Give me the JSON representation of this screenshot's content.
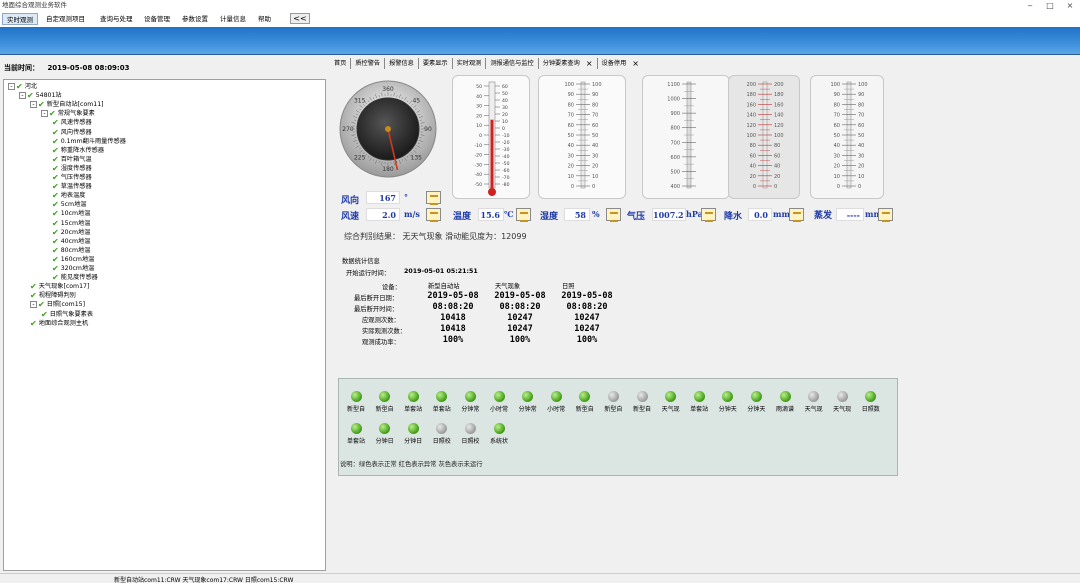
{
  "window": {
    "title": "地面综合观测业务软件"
  },
  "menu": {
    "items": [
      "实时观测",
      "自定观测项目",
      "查询与处理",
      "设备管理",
      "参数设置",
      "计量信息",
      "帮助"
    ],
    "collapse": "<<"
  },
  "current_time": {
    "label": "当前时间：",
    "value": "2019-05-08 08:09:03"
  },
  "tree": [
    {
      "label": "河北",
      "depth": 0,
      "expander": "-"
    },
    {
      "label": "54801站",
      "depth": 1,
      "expander": "-"
    },
    {
      "label": "新型自动站[com11]",
      "depth": 2,
      "expander": "-"
    },
    {
      "label": "常规气象要素",
      "depth": 3,
      "expander": "-"
    },
    {
      "label": "风速传感器",
      "depth": 4
    },
    {
      "label": "风向传感器",
      "depth": 4
    },
    {
      "label": "0.1mm翻斗雨量传感器",
      "depth": 4
    },
    {
      "label": "称重降水传感器",
      "depth": 4
    },
    {
      "label": "百叶箱气温",
      "depth": 4
    },
    {
      "label": "湿度传感器",
      "depth": 4
    },
    {
      "label": "气压传感器",
      "depth": 4
    },
    {
      "label": "草温传感器",
      "depth": 4
    },
    {
      "label": "地表温度",
      "depth": 4
    },
    {
      "label": "5cm地温",
      "depth": 4
    },
    {
      "label": "10cm地温",
      "depth": 4
    },
    {
      "label": "15cm地温",
      "depth": 4
    },
    {
      "label": "20cm地温",
      "depth": 4
    },
    {
      "label": "40cm地温",
      "depth": 4
    },
    {
      "label": "80cm地温",
      "depth": 4
    },
    {
      "label": "160cm地温",
      "depth": 4
    },
    {
      "label": "320cm地温",
      "depth": 4
    },
    {
      "label": "能见度传感器",
      "depth": 4
    },
    {
      "label": "天气现象[com17]",
      "depth": 2
    },
    {
      "label": "视程障碍判别",
      "depth": 2
    },
    {
      "label": "日照[com15]",
      "depth": 2,
      "expander": "-"
    },
    {
      "label": "日照气象要素表",
      "depth": 3
    },
    {
      "label": "地面综合观测主机",
      "depth": 2
    }
  ],
  "status_bar": "新型自动站com11:CRW  天气现象com17:CRW  日照com15:CRW",
  "tabs": [
    {
      "label": "首页"
    },
    {
      "label": "质控警告"
    },
    {
      "label": "报警信息"
    },
    {
      "label": "要素显示"
    },
    {
      "label": "实时观测"
    },
    {
      "label": "测报通信与监控"
    },
    {
      "label": "分钟要素查询",
      "close": "×"
    },
    {
      "label": "设备停用",
      "close": "×"
    }
  ],
  "gauges": {
    "wind_dir": {
      "label": "风向",
      "value": "167",
      "unit": "°",
      "angle_deg": 167,
      "dial": [
        "360",
        "45",
        "90",
        "135",
        "180",
        "225",
        "270",
        "315"
      ]
    },
    "wind_speed": {
      "label": "风速",
      "value": "2.0",
      "unit": "m/s"
    },
    "temperature": {
      "label": "温度",
      "value": "15.6",
      "unit": "℃",
      "level": 15.6,
      "scale_left": [
        "50",
        "40",
        "30",
        "20",
        "10",
        "0",
        "-10",
        "-20",
        "-30",
        "-40",
        "-50"
      ],
      "scale_right": [
        "60",
        "50",
        "40",
        "30",
        "20",
        "10",
        "0",
        "-10",
        "-20",
        "-30",
        "-40",
        "-50",
        "-60",
        "-70",
        "-80"
      ]
    },
    "humidity": {
      "label": "湿度",
      "value": "58",
      "unit": "%",
      "scale": [
        "100",
        "90",
        "80",
        "70",
        "60",
        "50",
        "40",
        "30",
        "20",
        "10",
        "0"
      ]
    },
    "pressure": {
      "label": "气压",
      "value": "1007.2",
      "unit": "hPa",
      "scale": [
        "1100",
        "1000",
        "900",
        "800",
        "700",
        "600",
        "500",
        "400"
      ]
    },
    "precip": {
      "label": "降水",
      "value": "0.0",
      "unit": "mm",
      "scale": [
        "200",
        "180",
        "160",
        "140",
        "120",
        "100",
        "80",
        "60",
        "40",
        "20",
        "0"
      ]
    },
    "evap": {
      "label": "蒸发",
      "value": "----",
      "unit": "mm",
      "scale": [
        "100",
        "90",
        "80",
        "70",
        "60",
        "50",
        "40",
        "30",
        "20",
        "10",
        "0"
      ]
    }
  },
  "judge": {
    "text": "综合判别结果：  无天气现象   滑动能见度为：12099"
  },
  "stats": {
    "title": "数据统计信息",
    "start_label": "开始运行时间：",
    "start_value": "2019-05-01 05:21:51",
    "row_labels": [
      "设备：",
      "最后断开日期：",
      "最后断开时间：",
      "应观测次数：",
      "实际观测次数：",
      "观测成功率："
    ],
    "devices": [
      {
        "name": "新型自动站",
        "date": "2019-05-08",
        "time": "08:08:20",
        "expected": "10418",
        "actual": "10418",
        "rate": "100%"
      },
      {
        "name": "天气现象",
        "date": "2019-05-08",
        "time": "08:08:20",
        "expected": "10247",
        "actual": "10247",
        "rate": "100%"
      },
      {
        "name": "日照",
        "date": "2019-05-08",
        "time": "08:08:20",
        "expected": "10247",
        "actual": "10247",
        "rate": "100%"
      }
    ]
  },
  "leds": [
    {
      "label": "新型自",
      "status": "green"
    },
    {
      "label": "新型自",
      "status": "green"
    },
    {
      "label": "单套站",
      "status": "green"
    },
    {
      "label": "单套站",
      "status": "green"
    },
    {
      "label": "分钟常",
      "status": "green"
    },
    {
      "label": "小时常",
      "status": "green"
    },
    {
      "label": "分钟常",
      "status": "green"
    },
    {
      "label": "小时常",
      "status": "green"
    },
    {
      "label": "新型自",
      "status": "green"
    },
    {
      "label": "新型自",
      "status": "gray"
    },
    {
      "label": "新型自",
      "status": "gray"
    },
    {
      "label": "天气现",
      "status": "green"
    },
    {
      "label": "单套站",
      "status": "green"
    },
    {
      "label": "分钟天",
      "status": "green"
    },
    {
      "label": "分钟天",
      "status": "green"
    },
    {
      "label": "雨滴谱",
      "status": "green"
    },
    {
      "label": "天气现",
      "status": "gray"
    },
    {
      "label": "天气现",
      "status": "gray"
    },
    {
      "label": "日照数",
      "status": "green"
    },
    {
      "label": "单套站",
      "status": "green"
    },
    {
      "label": "分钟日",
      "status": "green"
    },
    {
      "label": "分钟日",
      "status": "green"
    },
    {
      "label": "日照校",
      "status": "gray"
    },
    {
      "label": "日照校",
      "status": "gray"
    },
    {
      "label": "系统状",
      "status": "green"
    }
  ],
  "legend": "说明：绿色表示正常 红色表示异常 灰色表示未运行",
  "colors": {
    "accent_blue": "#1f73c7",
    "value_blue": "#1f3aa8",
    "ok_green": "#3f9a13",
    "mercury_red": "#d02020"
  }
}
